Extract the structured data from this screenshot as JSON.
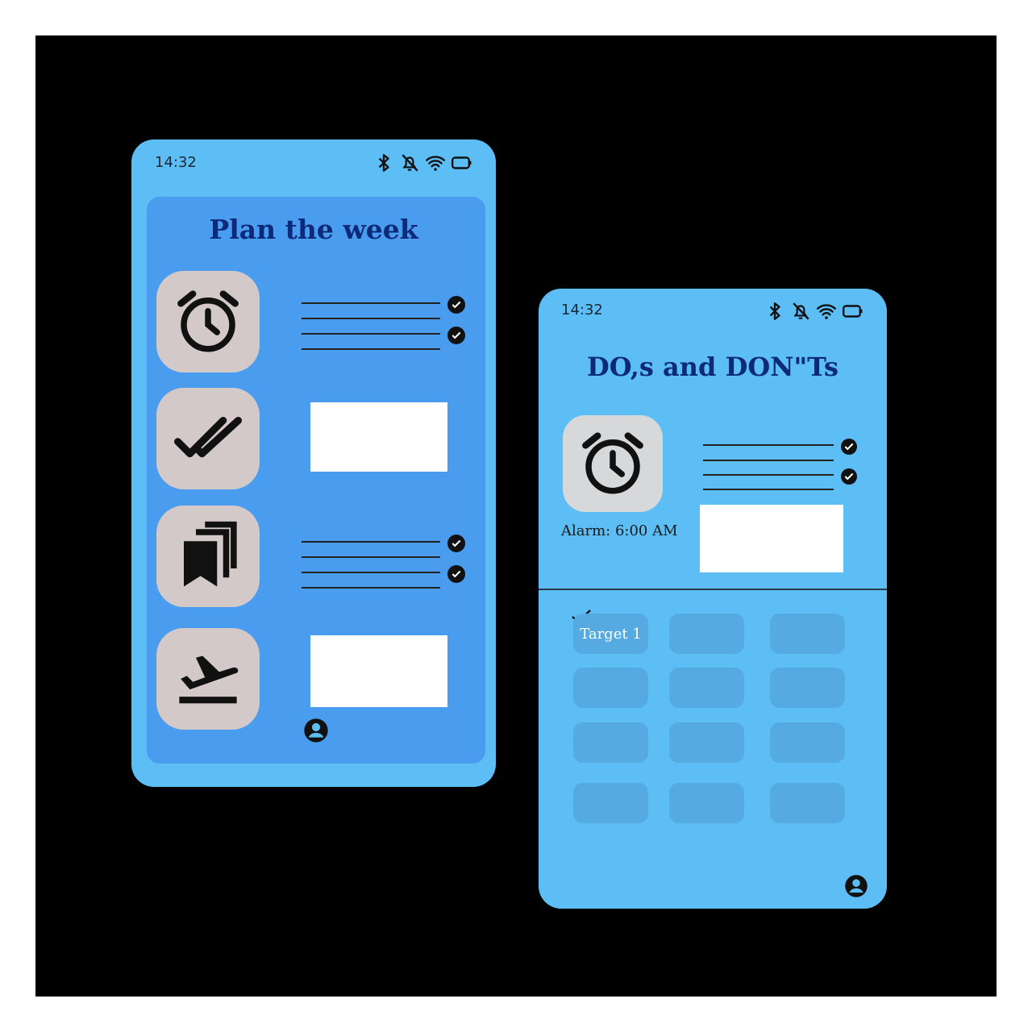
{
  "colors": {
    "frame": "#000000",
    "phone_bg": "#5dbdf5",
    "panel_bg": "#4a9cef",
    "tile_bg": "#d3c9c9",
    "title": "#0d2a7a",
    "grid_cell": "#56aae2"
  },
  "phone1": {
    "status": {
      "time": "14:32",
      "icons": [
        "bluetooth-icon",
        "bell-off-icon",
        "wifi-icon",
        "battery-icon"
      ]
    },
    "title": "Plan the week",
    "tiles": [
      {
        "icon": "alarm-clock-icon"
      },
      {
        "icon": "double-check-icon"
      },
      {
        "icon": "bookmarks-icon"
      },
      {
        "icon": "airplane-departure-icon"
      }
    ],
    "profile_icon": "user-circle-icon"
  },
  "phone2": {
    "status": {
      "time": "14:32",
      "icons": [
        "bluetooth-icon",
        "bell-off-icon",
        "wifi-icon",
        "battery-icon"
      ]
    },
    "title": "DO,s and DON\"Ts",
    "alarm_label": "Alarm: 6:00 AM",
    "targets": [
      {
        "label": "Target 1",
        "checked": true
      },
      {
        "label": ""
      },
      {
        "label": ""
      },
      {
        "label": ""
      },
      {
        "label": ""
      },
      {
        "label": ""
      },
      {
        "label": ""
      },
      {
        "label": ""
      },
      {
        "label": ""
      },
      {
        "label": ""
      },
      {
        "label": ""
      },
      {
        "label": ""
      }
    ],
    "profile_icon": "user-circle-icon"
  }
}
